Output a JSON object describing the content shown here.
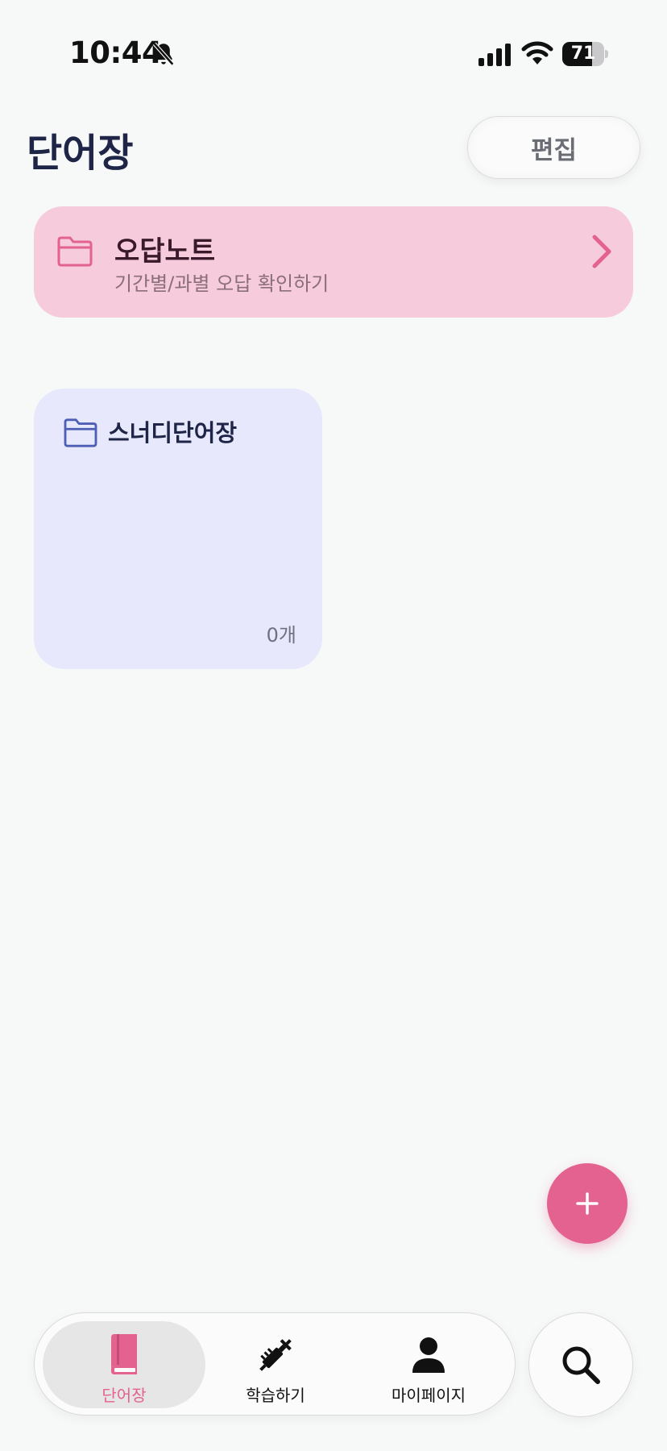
{
  "status_bar": {
    "time": "10:44",
    "battery_level": "71",
    "battery_fraction": 0.71
  },
  "header": {
    "title": "단어장",
    "edit_label": "편집"
  },
  "wrong_note": {
    "title": "오답노트",
    "subtitle": "기간별/과별 오답 확인하기",
    "icon": "folder-icon",
    "accent_color": "#e3628f",
    "background_color": "#f6cbdc"
  },
  "folders": [
    {
      "name": "스너디단어장",
      "count": "0개",
      "icon": "folder-icon",
      "background_color": "#e7e8fb"
    }
  ],
  "fab": {
    "icon": "plus-icon",
    "color": "#e3628f"
  },
  "tab_bar": {
    "items": [
      {
        "label": "단어장",
        "icon": "book-icon",
        "active": true
      },
      {
        "label": "학습하기",
        "icon": "syringe-icon",
        "active": false
      },
      {
        "label": "마이페이지",
        "icon": "person-icon",
        "active": false
      }
    ],
    "search_icon": "search-icon"
  }
}
